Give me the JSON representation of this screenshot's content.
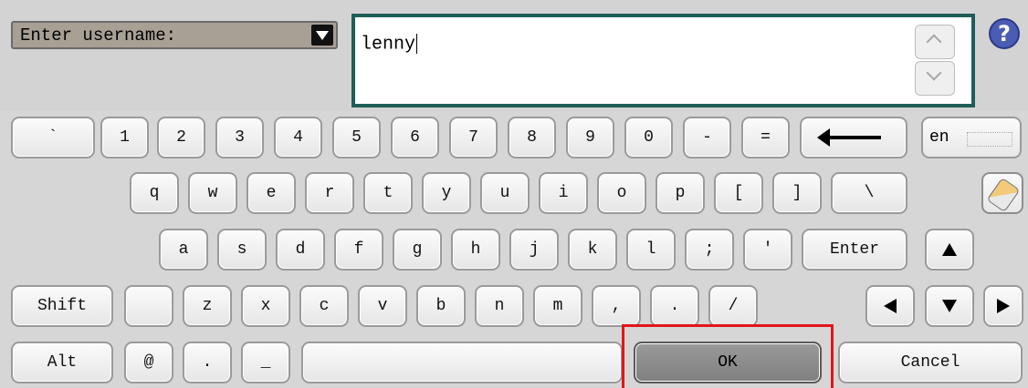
{
  "prompt": {
    "label": "Enter username:"
  },
  "input": {
    "value": "lenny"
  },
  "help": {
    "label": "?"
  },
  "keys": {
    "row1": [
      "`",
      "1",
      "2",
      "3",
      "4",
      "5",
      "6",
      "7",
      "8",
      "9",
      "0",
      "-",
      "="
    ],
    "row2": [
      "q",
      "w",
      "e",
      "r",
      "t",
      "y",
      "u",
      "i",
      "o",
      "p",
      "[",
      "]",
      "\\"
    ],
    "row3": [
      "a",
      "s",
      "d",
      "f",
      "g",
      "h",
      "j",
      "k",
      "l",
      ";",
      "'"
    ],
    "row4": [
      "z",
      "x",
      "c",
      "v",
      "b",
      "n",
      "m",
      ",",
      ".",
      "/"
    ],
    "row5": [
      "@",
      ".",
      "_"
    ]
  },
  "special": {
    "lang": "en",
    "enter": "Enter",
    "shift": "Shift",
    "alt": "Alt",
    "ok": "OK",
    "cancel": "Cancel"
  },
  "icons": {
    "backspace": "backspace-icon",
    "eraser": "eraser-icon",
    "up": "arrow-up-icon",
    "down": "arrow-down-icon",
    "left": "arrow-left-icon",
    "right": "arrow-right-icon",
    "help": "help-icon",
    "dropdown": "dropdown-icon",
    "keyboard": "keyboard-icon"
  },
  "colors": {
    "input_border": "#1f5e58",
    "ok_highlight": "#e0161b",
    "prompt_bg": "#a89f95"
  }
}
